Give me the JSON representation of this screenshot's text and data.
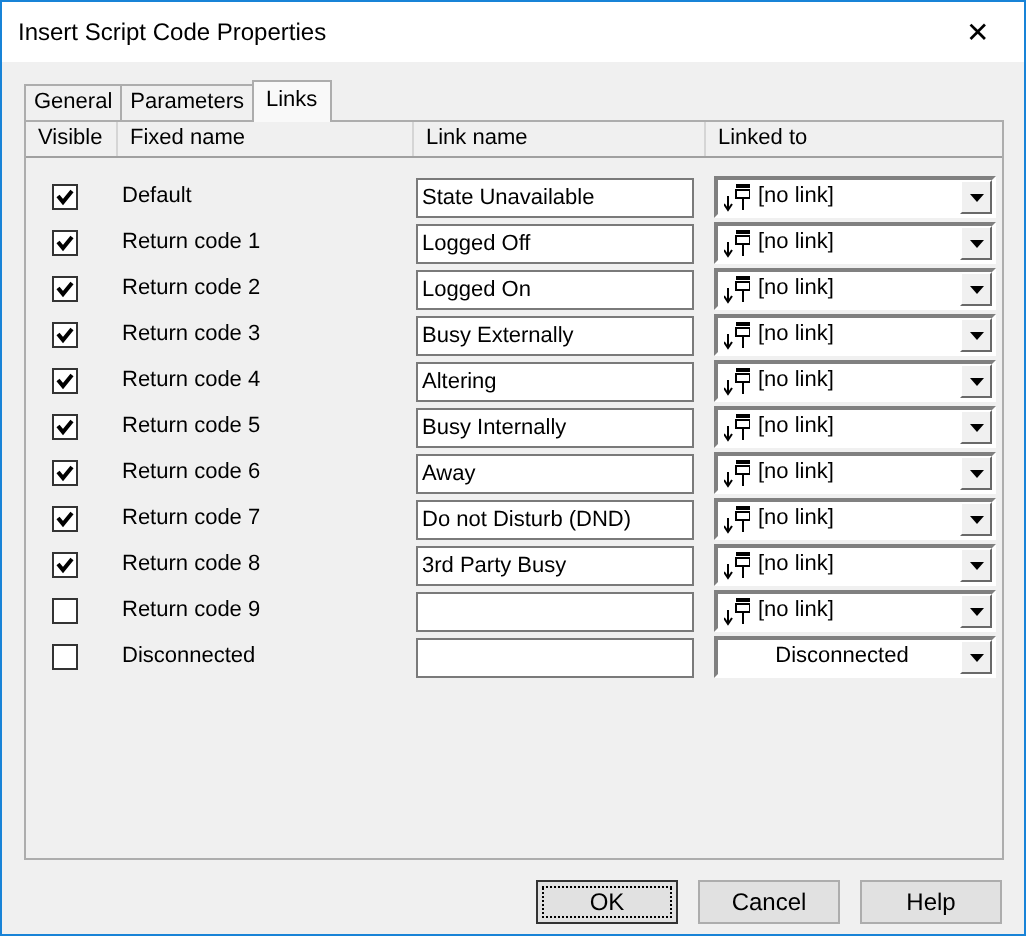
{
  "window": {
    "title": "Insert Script Code Properties",
    "close": "✕"
  },
  "tabs": [
    {
      "label": "General",
      "selected": false
    },
    {
      "label": "Parameters",
      "selected": false
    },
    {
      "label": "Links",
      "selected": true
    }
  ],
  "table": {
    "columns": [
      "Visible",
      "Fixed name",
      "Link name",
      "Linked to"
    ],
    "rows": [
      {
        "visible": true,
        "fixed_name": "Default",
        "link_name": "State Unavailable",
        "linked_to": {
          "kind": "link",
          "text": "[no link]"
        }
      },
      {
        "visible": true,
        "fixed_name": "Return code 1",
        "link_name": "Logged Off",
        "linked_to": {
          "kind": "link",
          "text": "[no link]"
        }
      },
      {
        "visible": true,
        "fixed_name": "Return code 2",
        "link_name": "Logged On",
        "linked_to": {
          "kind": "link",
          "text": "[no link]"
        }
      },
      {
        "visible": true,
        "fixed_name": "Return code 3",
        "link_name": "Busy Externally",
        "linked_to": {
          "kind": "link",
          "text": "[no link]"
        }
      },
      {
        "visible": true,
        "fixed_name": "Return code 4",
        "link_name": "Altering",
        "linked_to": {
          "kind": "link",
          "text": "[no link]"
        }
      },
      {
        "visible": true,
        "fixed_name": "Return code 5",
        "link_name": "Busy Internally",
        "linked_to": {
          "kind": "link",
          "text": "[no link]"
        }
      },
      {
        "visible": true,
        "fixed_name": "Return code 6",
        "link_name": "Away",
        "linked_to": {
          "kind": "link",
          "text": "[no link]"
        }
      },
      {
        "visible": true,
        "fixed_name": "Return code 7",
        "link_name": "Do not Disturb (DND)",
        "linked_to": {
          "kind": "link",
          "text": "[no link]"
        }
      },
      {
        "visible": true,
        "fixed_name": "Return code 8",
        "link_name": "3rd Party Busy",
        "linked_to": {
          "kind": "link",
          "text": "[no link]"
        }
      },
      {
        "visible": false,
        "fixed_name": "Return code 9",
        "linked_to": {
          "kind": "link",
          "text": "[no link]"
        }
      },
      {
        "visible": false,
        "fixed_name": "Disconnected",
        "linked_to": {
          "kind": "plain",
          "text": "Disconnected"
        }
      }
    ]
  },
  "buttons": [
    {
      "label": "OK",
      "focused": true
    },
    {
      "label": "Cancel",
      "focused": false
    },
    {
      "label": "Help",
      "focused": false
    }
  ]
}
